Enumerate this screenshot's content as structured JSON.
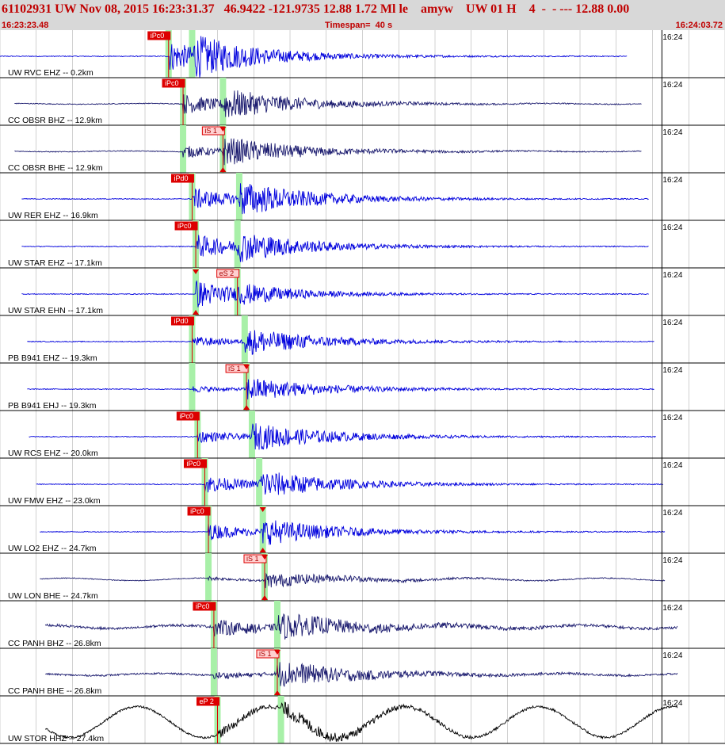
{
  "header": {
    "title": "61102931 UW Nov 08, 2015 16:23:31.37   46.9422 -121.9735 12.88 1.72 Ml le    amyw    UW 01 H    4  -  - --- 12.88 0.00",
    "start_time": "16:23:23.48",
    "timespan": "Timespan=  40 s",
    "end_time": "16:24:03.72"
  },
  "colors": {
    "title": "#c00000",
    "header_bg": "#d8d8d8",
    "trace_ehz": "#0000dd",
    "trace_bh": "#1a1a6e",
    "trace_hhz": "#000000",
    "pick_box": "#dd0000",
    "pick_highlight": "#a8f0a8",
    "grid": "#000000"
  },
  "chart_data": {
    "type": "line",
    "x_unit": "s",
    "time_range": [
      0,
      40
    ],
    "minute_tick_label": "16:24",
    "minute_tick_time": 36.52,
    "traces": [
      {
        "label": "UW RVC EHZ -- 0.2km",
        "color": "trace_ehz",
        "start": 0,
        "end": 34.6,
        "p_time": 9.3,
        "s_time": 10.6,
        "p_label": "iPc0",
        "s_label": "",
        "p_marker": false,
        "s_marker": false,
        "noise": 0.02,
        "p_amp": 0.75,
        "s_amp": 0.7,
        "drift": 0
      },
      {
        "label": "CC OBSR BHZ -- 12.9km",
        "color": "trace_bh",
        "start": 0.8,
        "end": 35.4,
        "p_time": 10.1,
        "s_time": 12.3,
        "p_label": "iPc0",
        "s_label": "",
        "p_marker": false,
        "s_marker": false,
        "noise": 0.02,
        "p_amp": 0.5,
        "s_amp": 0.6,
        "drift": 0.02
      },
      {
        "label": "CC OBSR BHE -- 12.9km",
        "color": "trace_bh",
        "start": 0.8,
        "end": 35.4,
        "p_time": 10.1,
        "s_time": 12.3,
        "p_label": "",
        "s_label": "iS 1",
        "p_marker": false,
        "s_marker": true,
        "noise": 0.02,
        "p_amp": 0.3,
        "s_amp": 0.6,
        "drift": 0.02
      },
      {
        "label": "UW RER EHZ -- 16.9km",
        "color": "trace_ehz",
        "start": 1.2,
        "end": 35.8,
        "p_time": 10.6,
        "s_time": 13.2,
        "p_label": "iPd0",
        "s_label": "",
        "p_marker": false,
        "s_marker": false,
        "noise": 0.02,
        "p_amp": 0.55,
        "s_amp": 0.7,
        "drift": 0
      },
      {
        "label": "UW STAR EHZ -- 17.1km",
        "color": "trace_ehz",
        "start": 1.2,
        "end": 35.8,
        "p_time": 10.8,
        "s_time": 13.1,
        "p_label": "iPc0",
        "s_label": "",
        "p_marker": false,
        "s_marker": false,
        "noise": 0.02,
        "p_amp": 0.6,
        "s_amp": 0.55,
        "drift": 0
      },
      {
        "label": "UW STAR EHN -- 17.1km",
        "color": "trace_ehz",
        "start": 1.2,
        "end": 35.8,
        "p_time": 10.8,
        "s_time": 13.1,
        "p_label": "",
        "s_label": "eS 2",
        "p_marker": true,
        "s_marker": false,
        "noise": 0.02,
        "p_amp": 0.7,
        "s_amp": 0.3,
        "drift": 0
      },
      {
        "label": "PB B941 EHZ -- 19.3km",
        "color": "trace_ehz",
        "start": 1.5,
        "end": 36.1,
        "p_time": 10.6,
        "s_time": 13.5,
        "p_label": "iPd0",
        "s_label": "",
        "p_marker": false,
        "s_marker": false,
        "noise": 0.02,
        "p_amp": 0.25,
        "s_amp": 0.6,
        "drift": 0
      },
      {
        "label": "PB B941 EHJ -- 19.3km",
        "color": "trace_ehz",
        "start": 1.5,
        "end": 36.1,
        "p_time": 10.6,
        "s_time": 13.6,
        "p_label": "",
        "s_label": "iS 1",
        "p_marker": false,
        "s_marker": true,
        "noise": 0.02,
        "p_amp": 0.15,
        "s_amp": 0.55,
        "drift": 0
      },
      {
        "label": "UW RCS EHZ -- 20.0km",
        "color": "trace_ehz",
        "start": 1.6,
        "end": 36.2,
        "p_time": 10.9,
        "s_time": 13.9,
        "p_label": "iPc0",
        "s_label": "",
        "p_marker": false,
        "s_marker": false,
        "noise": 0.02,
        "p_amp": 0.3,
        "s_amp": 0.6,
        "drift": 0
      },
      {
        "label": "UW FMW EHZ -- 23.0km",
        "color": "trace_ehz",
        "start": 2.0,
        "end": 36.6,
        "p_time": 11.3,
        "s_time": 14.3,
        "p_label": "iPc0",
        "s_label": "",
        "p_marker": false,
        "s_marker": false,
        "noise": 0.02,
        "p_amp": 0.45,
        "s_amp": 0.6,
        "drift": 0
      },
      {
        "label": "UW LO2 EHZ -- 24.7km",
        "color": "trace_ehz",
        "start": 2.2,
        "end": 36.7,
        "p_time": 11.5,
        "s_time": 14.5,
        "p_label": "iPc0",
        "s_label": "",
        "p_marker": false,
        "s_marker": true,
        "noise": 0.02,
        "p_amp": 0.4,
        "s_amp": 0.55,
        "drift": 0
      },
      {
        "label": "UW LON BHE -- 24.7km",
        "color": "trace_bh",
        "start": 2.2,
        "end": 36.7,
        "p_time": 11.5,
        "s_time": 14.6,
        "p_label": "",
        "s_label": "iS 1",
        "p_marker": false,
        "s_marker": true,
        "noise": 0.02,
        "p_amp": 0.08,
        "s_amp": 0.35,
        "drift": 0.06
      },
      {
        "label": "CC PANH BHZ -- 26.8km",
        "color": "trace_bh",
        "start": 2.5,
        "end": 37.4,
        "p_time": 11.8,
        "s_time": 15.3,
        "p_label": "iPc0",
        "s_label": "",
        "p_marker": false,
        "s_marker": false,
        "noise": 0.06,
        "p_amp": 0.4,
        "s_amp": 0.55,
        "drift": 0.08
      },
      {
        "label": "CC PANH BHE -- 26.8km",
        "color": "trace_bh",
        "start": 2.5,
        "end": 37.4,
        "p_time": 11.8,
        "s_time": 15.3,
        "p_label": "",
        "s_label": "iS 1",
        "p_marker": false,
        "s_marker": true,
        "noise": 0.04,
        "p_amp": 0.15,
        "s_amp": 0.6,
        "drift": 0.05
      },
      {
        "label": "UW STOR HHZ -- 27.4km",
        "color": "trace_hhz",
        "start": 2.5,
        "end": 37.4,
        "p_time": 12.0,
        "s_time": 15.5,
        "p_label": "eP 2",
        "s_label": "",
        "p_marker": false,
        "s_marker": false,
        "noise": 0.05,
        "p_amp": 0.2,
        "s_amp": 0.3,
        "drift": 0.75
      }
    ]
  }
}
